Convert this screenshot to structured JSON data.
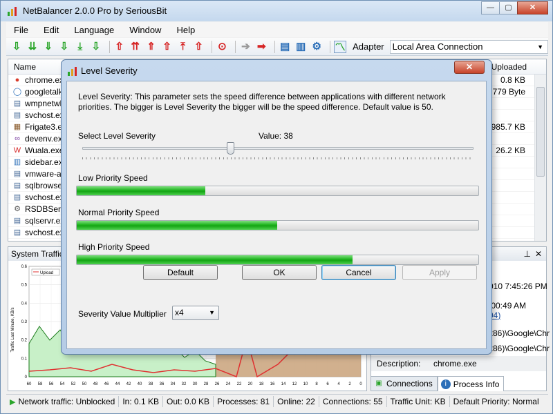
{
  "window": {
    "title": "NetBalancer 2.0.0 Pro by SeriousBit",
    "buttons": {
      "minimize": "—",
      "maximize": "▢",
      "close": "✕"
    }
  },
  "menu": [
    "File",
    "Edit",
    "Language",
    "Window",
    "Help"
  ],
  "toolbar": {
    "adapter_label": "Adapter",
    "adapter_value": "Local Area Connection",
    "icons": [
      "download-limit-icon",
      "download-priority-icon",
      "upload-icon",
      "ignore-icon",
      "block-icon",
      "settings-icon",
      "chart-icon"
    ]
  },
  "process_list": {
    "header_name": "Name",
    "header_uploaded": "Uploaded",
    "rows": [
      {
        "name": "chrome.exe",
        "uploaded": "0.8 KB",
        "icon": "chrome-icon"
      },
      {
        "name": "googletalk.",
        "uploaded": "779 Byte",
        "icon": "talk-icon"
      },
      {
        "name": "wmpnetwk.",
        "uploaded": "",
        "icon": "app-icon"
      },
      {
        "name": "svchost.exe",
        "uploaded": "",
        "icon": "app-icon"
      },
      {
        "name": "Frigate3.ex",
        "uploaded": "985.7 KB",
        "icon": "frigate-icon"
      },
      {
        "name": "devenv.exe",
        "uploaded": "",
        "icon": "devenv-icon"
      },
      {
        "name": "Wuala.exe",
        "uploaded": "26.2 KB",
        "icon": "wuala-icon"
      },
      {
        "name": "sidebar.exe",
        "uploaded": "",
        "icon": "sidebar-icon"
      },
      {
        "name": "vmware-au",
        "uploaded": "",
        "icon": "app-icon"
      },
      {
        "name": "sqlbrowser",
        "uploaded": "",
        "icon": "app-icon"
      },
      {
        "name": "svchost.exe",
        "uploaded": "",
        "icon": "app-icon"
      },
      {
        "name": "RSDBServe",
        "uploaded": "",
        "icon": "gear-icon"
      },
      {
        "name": "sqlservr.exe",
        "uploaded": "",
        "icon": "app-icon"
      },
      {
        "name": "svchost.exe",
        "uploaded": "",
        "icon": "app-icon"
      }
    ]
  },
  "traffic_pane": {
    "title": "System Traffic",
    "ylabel": "Traffic Last Minute, KB/s",
    "legend": "Upload",
    "y_ticks": [
      "0.6",
      "0.5",
      "0.4",
      "0.3",
      "0.2",
      "0.1",
      "0"
    ],
    "x_ticks": [
      "60",
      "58",
      "56",
      "54",
      "52",
      "50",
      "48",
      "46",
      "44",
      "42",
      "40",
      "38",
      "36",
      "34",
      "32",
      "30",
      "28",
      "26",
      "24",
      "22",
      "20",
      "18",
      "16",
      "14",
      "12",
      "10",
      "8",
      "6",
      "4",
      "2",
      "0"
    ]
  },
  "info_pane": {
    "pin": "📌",
    "close": "✕",
    "lines": [
      "010 7:45:26 PM",
      ":00:49 AM",
      "04)",
      "x86)\\Google\\Chr",
      "x86)\\Google\\Chr"
    ],
    "description_label": "Description:",
    "description_value": "chrome.exe"
  },
  "tabs": [
    {
      "label": "Connections",
      "active": false,
      "icon": "connections-icon"
    },
    {
      "label": "Process Info",
      "active": true,
      "icon": "info-icon"
    }
  ],
  "statusbar": {
    "network": "Network traffic: Unblocked",
    "in": "In: 0.1 KB",
    "out": "Out: 0.0 KB",
    "processes": "Processes: 81",
    "online": "Online: 22",
    "connections": "Connections: 55",
    "unit": "Traffic Unit: KB",
    "priority": "Default Priority: Normal"
  },
  "dialog": {
    "title": "Level Severity",
    "close": "✕",
    "description": "Level Severity: This parameter sets the speed difference between applications with different network priorities. The bigger is Level Severity the bigger will be the speed difference. Default value is 50.",
    "select_label": "Select Level Severity",
    "value_label": "Value: 38",
    "slider_value": 38,
    "slider_max": 100,
    "low_label": "Low Priority Speed",
    "low_fill": 0.32,
    "normal_label": "Normal Priority Speed",
    "normal_fill": 0.499,
    "high_label": "High Priority Speed",
    "high_fill": 0.687,
    "multiplier_label": "Severity Value Multiplier",
    "multiplier_value": "x4",
    "buttons": {
      "default": "Default",
      "ok": "OK",
      "cancel": "Cancel",
      "apply": "Apply"
    }
  },
  "colors": {
    "accent_green": "#1fb41f",
    "chart_fill": "#c8f0c8",
    "chart_brown": "#c9a27a",
    "upload_red": "#e03030"
  }
}
